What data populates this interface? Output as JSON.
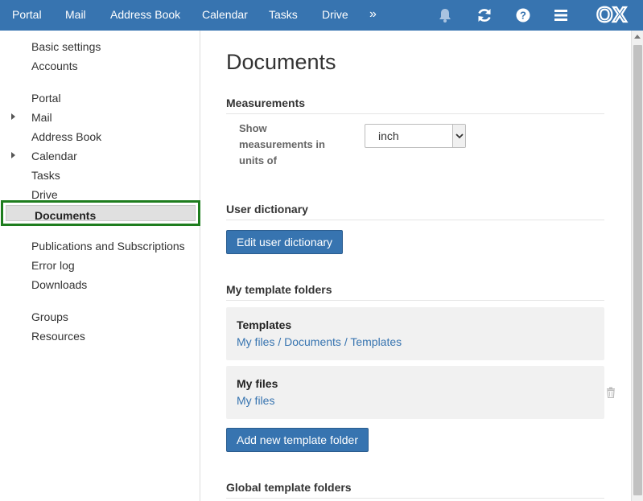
{
  "topnav": {
    "items": [
      "Portal",
      "Mail",
      "Address Book",
      "Calendar",
      "Tasks",
      "Drive"
    ],
    "more": "»",
    "logo": "OX"
  },
  "icons": {
    "notifications": "bell-icon",
    "refresh": "refresh-icon",
    "help": "question-icon",
    "menu": "hamburger-icon",
    "delete": "trash-icon"
  },
  "colors": {
    "accent": "#3774b0",
    "highlight_border": "#1e7d1e"
  },
  "sidebar": {
    "items": [
      "Basic settings",
      "Accounts",
      "Portal",
      "Mail",
      "Address Book",
      "Calendar",
      "Tasks",
      "Drive",
      "Documents",
      "Publications and Subscriptions",
      "Error log",
      "Downloads",
      "Groups",
      "Resources"
    ],
    "selected": "Documents"
  },
  "main": {
    "title": "Documents",
    "measurements": {
      "heading": "Measurements",
      "label": "Show measurements in units of",
      "value": "inch"
    },
    "dictionary": {
      "heading": "User dictionary",
      "button": "Edit user dictionary"
    },
    "templates": {
      "heading": "My template folders",
      "folders": [
        {
          "name": "Templates",
          "path": "My files / Documents / Templates"
        },
        {
          "name": "My files",
          "path": "My files"
        }
      ],
      "add_button": "Add new template folder"
    },
    "global": {
      "heading": "Global template folders"
    }
  }
}
